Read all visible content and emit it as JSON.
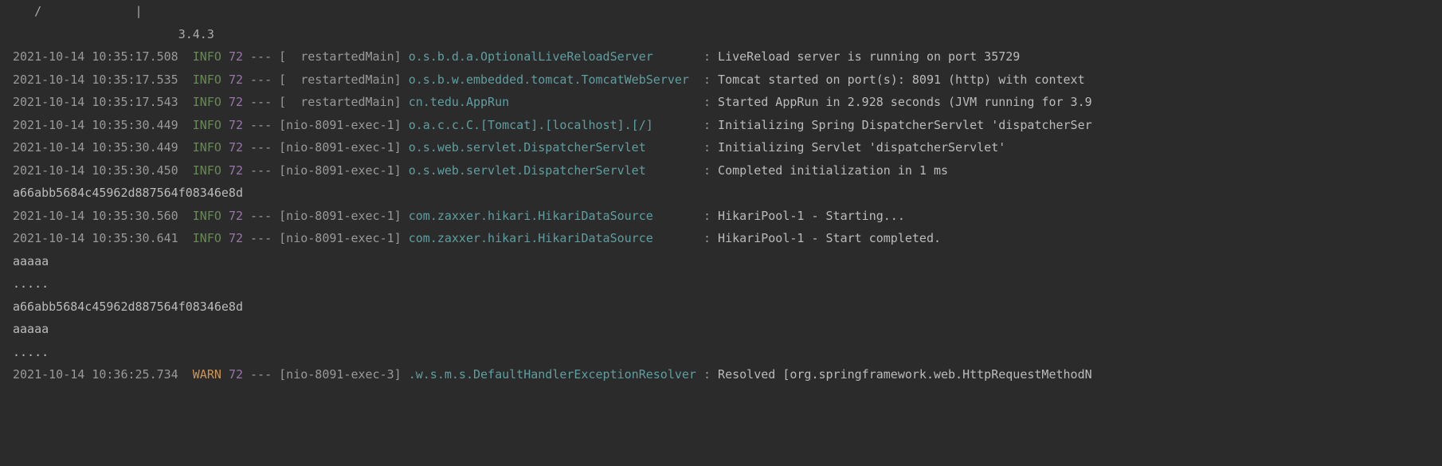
{
  "banner": {
    "line1": "   /             |    ",
    "line2": "                       3.4.3"
  },
  "lines": [
    {
      "type": "log",
      "timestamp": "2021-10-14 10:35:17.508",
      "level": "INFO",
      "pid": "72",
      "dashes": "---",
      "thread": "[  restartedMain]",
      "logger": "o.s.b.d.a.OptionalLiveReloadServer      ",
      "message": "LiveReload server is running on port 35729"
    },
    {
      "type": "log",
      "timestamp": "2021-10-14 10:35:17.535",
      "level": "INFO",
      "pid": "72",
      "dashes": "---",
      "thread": "[  restartedMain]",
      "logger": "o.s.b.w.embedded.tomcat.TomcatWebServer ",
      "message": "Tomcat started on port(s): 8091 (http) with context "
    },
    {
      "type": "log",
      "timestamp": "2021-10-14 10:35:17.543",
      "level": "INFO",
      "pid": "72",
      "dashes": "---",
      "thread": "[  restartedMain]",
      "logger": "cn.tedu.AppRun                          ",
      "message": "Started AppRun in 2.928 seconds (JVM running for 3.9"
    },
    {
      "type": "log",
      "timestamp": "2021-10-14 10:35:30.449",
      "level": "INFO",
      "pid": "72",
      "dashes": "---",
      "thread": "[nio-8091-exec-1]",
      "logger": "o.a.c.c.C.[Tomcat].[localhost].[/]      ",
      "message": "Initializing Spring DispatcherServlet 'dispatcherSer"
    },
    {
      "type": "log",
      "timestamp": "2021-10-14 10:35:30.449",
      "level": "INFO",
      "pid": "72",
      "dashes": "---",
      "thread": "[nio-8091-exec-1]",
      "logger": "o.s.web.servlet.DispatcherServlet       ",
      "message": "Initializing Servlet 'dispatcherServlet'"
    },
    {
      "type": "log",
      "timestamp": "2021-10-14 10:35:30.450",
      "level": "INFO",
      "pid": "72",
      "dashes": "---",
      "thread": "[nio-8091-exec-1]",
      "logger": "o.s.web.servlet.DispatcherServlet       ",
      "message": "Completed initialization in 1 ms"
    },
    {
      "type": "plain",
      "text": "a66abb5684c45962d887564f08346e8d"
    },
    {
      "type": "log",
      "timestamp": "2021-10-14 10:35:30.560",
      "level": "INFO",
      "pid": "72",
      "dashes": "---",
      "thread": "[nio-8091-exec-1]",
      "logger": "com.zaxxer.hikari.HikariDataSource      ",
      "message": "HikariPool-1 - Starting..."
    },
    {
      "type": "log",
      "timestamp": "2021-10-14 10:35:30.641",
      "level": "INFO",
      "pid": "72",
      "dashes": "---",
      "thread": "[nio-8091-exec-1]",
      "logger": "com.zaxxer.hikari.HikariDataSource      ",
      "message": "HikariPool-1 - Start completed."
    },
    {
      "type": "plain",
      "text": "aaaaa"
    },
    {
      "type": "plain",
      "text": "....."
    },
    {
      "type": "plain",
      "text": "a66abb5684c45962d887564f08346e8d"
    },
    {
      "type": "plain",
      "text": "aaaaa"
    },
    {
      "type": "plain",
      "text": "....."
    },
    {
      "type": "log",
      "timestamp": "2021-10-14 10:36:25.734",
      "level": "WARN",
      "pid": "72",
      "dashes": "---",
      "thread": "[nio-8091-exec-3]",
      "logger": ".w.s.m.s.DefaultHandlerExceptionResolver",
      "message": "Resolved [org.springframework.web.HttpRequestMethodN"
    }
  ]
}
